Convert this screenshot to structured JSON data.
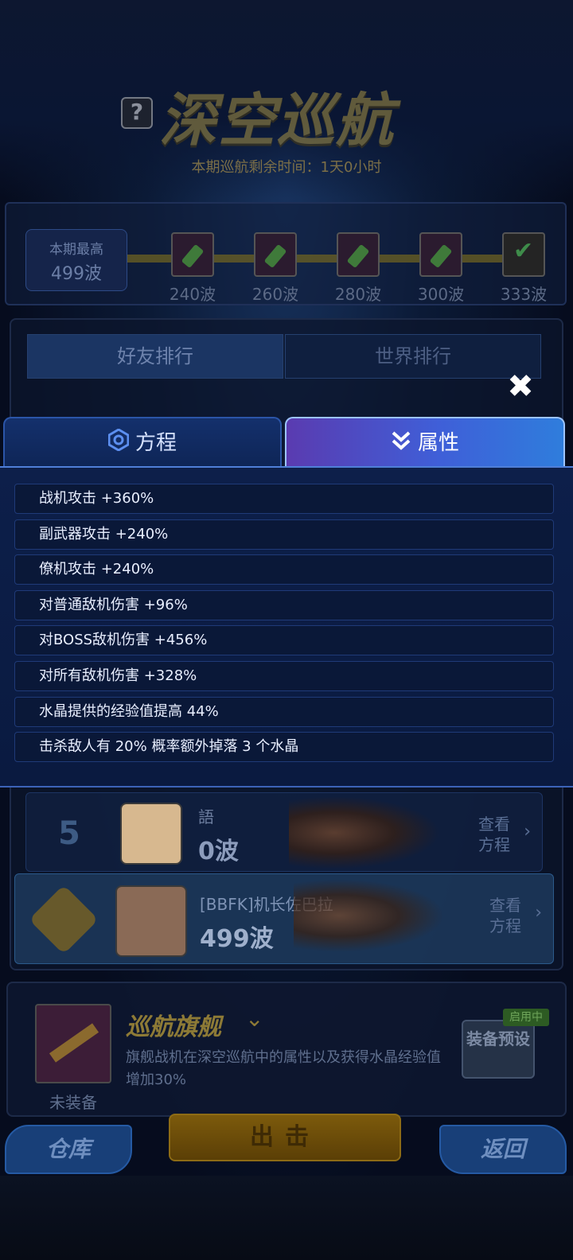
{
  "background": {
    "title": "深空巡航",
    "remaining": "本期巡航剩余时间：1天0小时",
    "best": {
      "label": "本期最高",
      "value": "499波"
    },
    "milestones": [
      "240波",
      "260波",
      "280波",
      "300波",
      "333波"
    ],
    "tabs": {
      "friends": "好友排行",
      "world": "世界排行"
    },
    "rows": [
      {
        "rank": "5",
        "name": "語",
        "score": "0波",
        "view": "查看方程"
      },
      {
        "name": "[BBFK]机长佐巴拉",
        "score": "499波",
        "view": "查看方程"
      }
    ],
    "flagship": {
      "title": "巡航旗舰",
      "status": "未装备",
      "desc": "旗舰战机在深空巡航中的属性以及获得水晶经验值增加30%",
      "preset": "装备预设",
      "badge": "启用中"
    },
    "buttons": {
      "warehouse": "仓库",
      "go": "出击",
      "back": "返回"
    }
  },
  "popup": {
    "tabs": {
      "formula": "方程",
      "attributes": "属性"
    },
    "active_tab": "attributes",
    "attributes": [
      "战机攻击 +360%",
      "副武器攻击 +240%",
      "僚机攻击 +240%",
      "对普通敌机伤害 +96%",
      "对BOSS敌机伤害 +456%",
      "对所有敌机伤害 +328%",
      "水晶提供的经验值提高 44%",
      "击杀敌人有 20% 概率额外掉落 3 个水晶"
    ]
  },
  "colors": {
    "accent": "#3f5fd8",
    "panel": "#0d1f4a",
    "text": "#e9efff"
  }
}
